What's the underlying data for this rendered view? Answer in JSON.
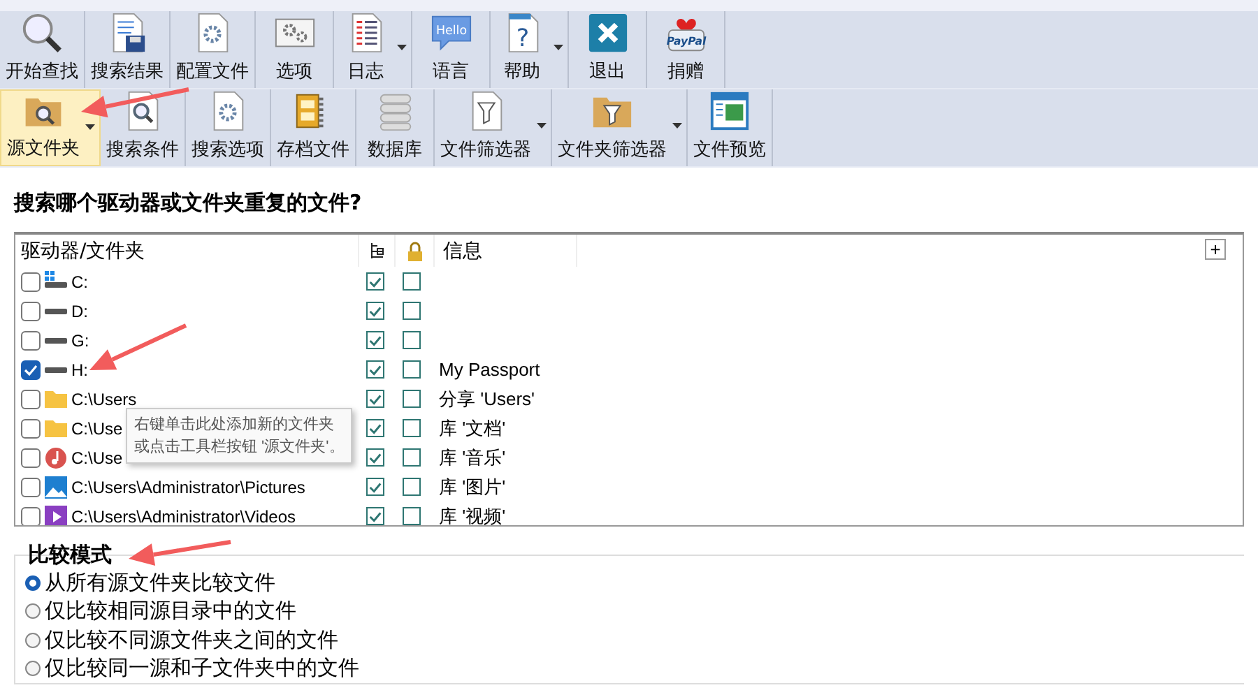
{
  "toolbar_rows": [
    {
      "items": [
        {
          "label": "开始查找",
          "dropdown": false,
          "selected": false
        },
        {
          "label": "搜索结果",
          "dropdown": false,
          "selected": false
        },
        {
          "label": "配置文件",
          "dropdown": false,
          "selected": false
        },
        {
          "label": "选项",
          "dropdown": false,
          "selected": false
        },
        {
          "label": "日志",
          "dropdown": true,
          "selected": false
        },
        {
          "label": "语言",
          "dropdown": false,
          "selected": false,
          "icon_text": "Hello"
        },
        {
          "label": "帮助",
          "dropdown": true,
          "selected": false,
          "icon_text": "?"
        },
        {
          "label": "退出",
          "dropdown": false,
          "selected": false
        },
        {
          "label": "捐赠",
          "dropdown": false,
          "selected": false,
          "icon_text": "PayPal"
        }
      ]
    },
    {
      "items": [
        {
          "label": "源文件夹",
          "dropdown": true,
          "selected": true
        },
        {
          "label": "搜索条件",
          "dropdown": false,
          "selected": false
        },
        {
          "label": "搜索选项",
          "dropdown": false,
          "selected": false
        },
        {
          "label": "存档文件",
          "dropdown": false,
          "selected": false
        },
        {
          "label": "数据库",
          "dropdown": false,
          "selected": false
        },
        {
          "label": "文件筛选器",
          "dropdown": true,
          "selected": false
        },
        {
          "label": "文件夹筛选器",
          "dropdown": true,
          "selected": false
        },
        {
          "label": "文件预览",
          "dropdown": false,
          "selected": false
        }
      ]
    }
  ],
  "heading": "搜索哪个驱动器或文件夹重复的文件?",
  "table": {
    "columns": [
      "驱动器/文件夹",
      "信息"
    ],
    "add_button": "+",
    "rows": [
      {
        "kind": "windows-drive",
        "path": "C:",
        "checked": false,
        "subfolders": true,
        "locked": false
      },
      {
        "kind": "drive",
        "path": "D:",
        "checked": false,
        "subfolders": true,
        "locked": false
      },
      {
        "kind": "drive",
        "path": "G:",
        "checked": false,
        "subfolders": true,
        "locked": false
      },
      {
        "kind": "drive",
        "path": "H:",
        "checked": true,
        "subfolders": true,
        "locked": false,
        "info": "My Passport"
      },
      {
        "kind": "folder",
        "path": "C:\\Users",
        "checked": false,
        "subfolders": true,
        "locked": false,
        "info": "分享 'Users'"
      },
      {
        "kind": "folder",
        "path": "C:\\Use",
        "checked": false,
        "subfolders": true,
        "locked": false,
        "info": "库 '文档'"
      },
      {
        "kind": "music",
        "path": "C:\\Use",
        "checked": false,
        "subfolders": true,
        "locked": false,
        "info": "库 '音乐'"
      },
      {
        "kind": "pictures",
        "path": "C:\\Users\\Administrator\\Pictures",
        "checked": false,
        "subfolders": true,
        "locked": false,
        "info": "库 '图片'"
      },
      {
        "kind": "videos",
        "path": "C:\\Users\\Administrator\\Videos",
        "checked": false,
        "subfolders": true,
        "locked": false,
        "info": "库 '视频'"
      }
    ]
  },
  "tooltip": {
    "lines": [
      "右键单击此处添加新的文件夹",
      "或点击工具栏按钮 '源文件夹'。"
    ]
  },
  "compare_mode": {
    "title": "比较模式",
    "options": [
      {
        "label": "从所有源文件夹比较文件",
        "selected": true
      },
      {
        "label": "仅比较相同源目录中的文件",
        "selected": false
      },
      {
        "label": "仅比较不同源文件夹之间的文件",
        "selected": false
      },
      {
        "label": "仅比较同一源和子文件夹中的文件",
        "selected": false
      }
    ]
  }
}
